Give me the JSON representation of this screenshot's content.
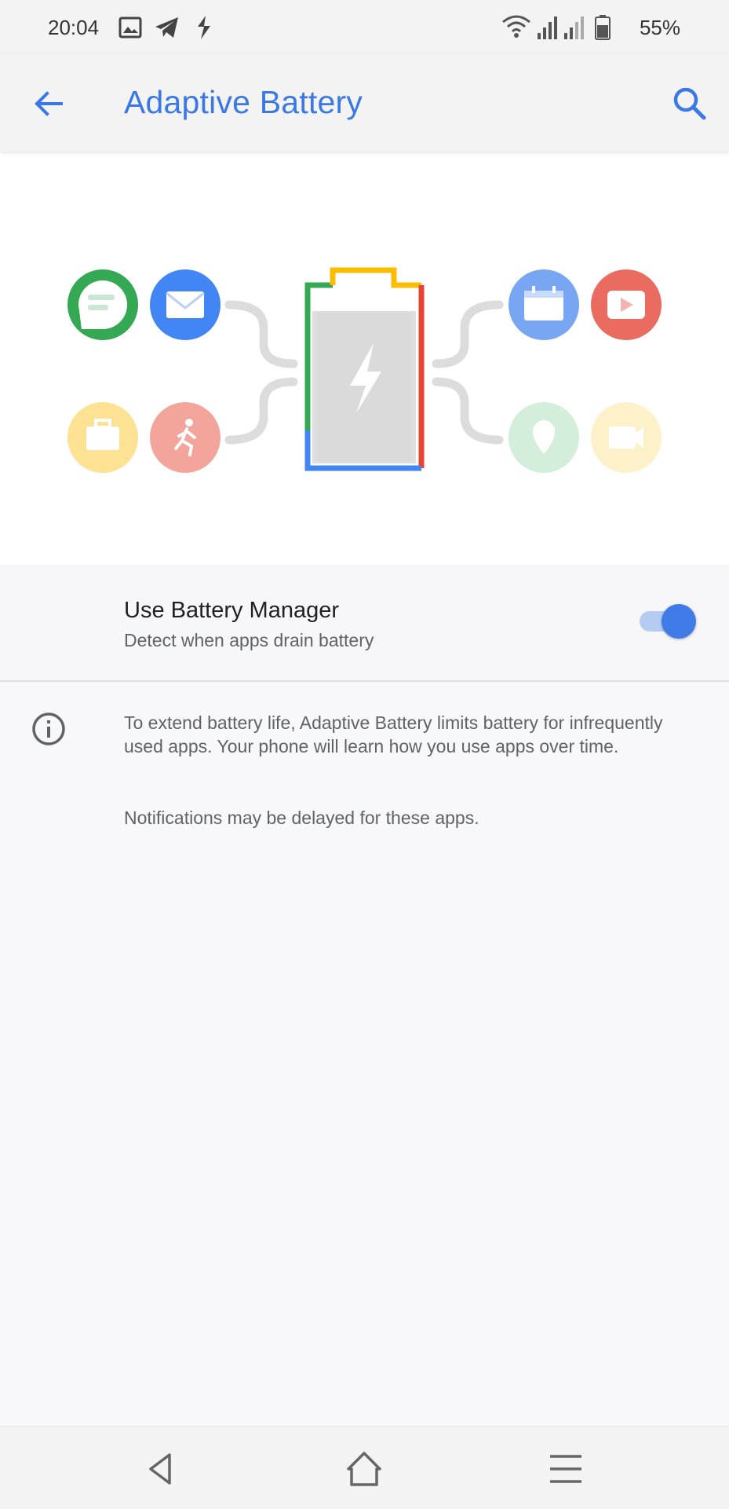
{
  "status_bar": {
    "time": "20:04",
    "left_icons": [
      "image-notification-icon",
      "telegram-icon",
      "app-notification-icon"
    ],
    "right_icons": [
      "wifi-icon",
      "signal-icon",
      "signal-icon",
      "battery-icon"
    ],
    "battery_percent": "55%"
  },
  "app_bar": {
    "back_icon": "arrow-back-icon",
    "title": "Adaptive Battery",
    "search_icon": "search-icon"
  },
  "illustration": {
    "icons": [
      "chat-icon",
      "mail-icon",
      "calendar-icon",
      "youtube-icon",
      "briefcase-icon",
      "running-icon",
      "location-icon",
      "video-icon"
    ]
  },
  "battery_manager": {
    "title": "Use Battery Manager",
    "summary": "Detect when apps drain battery",
    "enabled": true
  },
  "info": {
    "icon": "info-icon",
    "text": "To extend battery life, Adaptive Battery limits battery for infrequently used apps. Your phone will learn how you use apps over time.",
    "note": "Notifications may be delayed for these apps."
  },
  "nav_bar": {
    "buttons": [
      "back-triangle-icon",
      "home-icon",
      "menu-icon"
    ]
  },
  "colors": {
    "accent": "#3a79e3",
    "green": "#34a853",
    "blue": "#4285f4",
    "yellow": "#fbbc04",
    "red": "#ea4335"
  }
}
